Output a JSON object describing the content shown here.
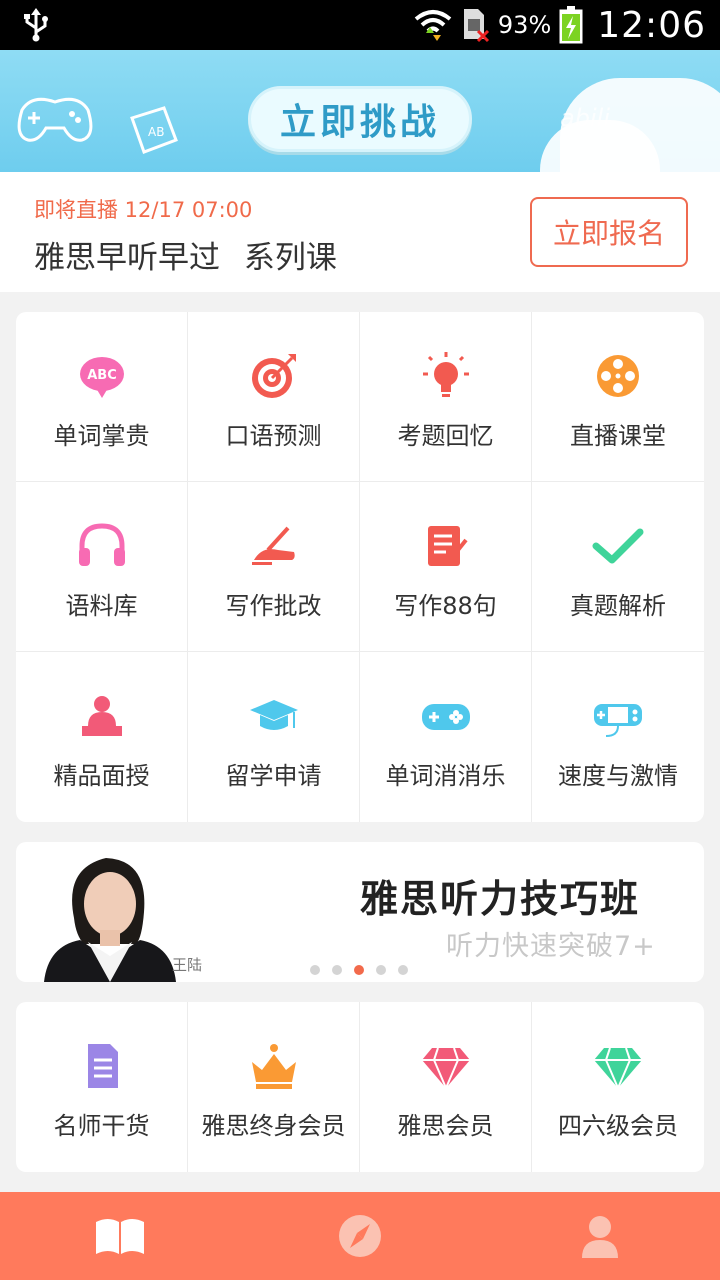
{
  "status_bar": {
    "battery_percent": "93%",
    "time": "12:06"
  },
  "banner": {
    "challenge_label": "立即挑战",
    "deco_text": "abili"
  },
  "live": {
    "note": "即将直播 12/17 07:00",
    "title": "雅思早听早过 系列课",
    "signup_label": "立即报名"
  },
  "features": [
    {
      "label": "单词掌贵",
      "icon": "abc-bubble-icon",
      "color": "#f76bb3"
    },
    {
      "label": "口语预测",
      "icon": "target-icon",
      "color": "#f25a50"
    },
    {
      "label": "考题回忆",
      "icon": "lightbulb-icon",
      "color": "#f25a50"
    },
    {
      "label": "直播课堂",
      "icon": "film-reel-icon",
      "color": "#fa9a34"
    },
    {
      "label": "语料库",
      "icon": "headphones-icon",
      "color": "#f76bb3"
    },
    {
      "label": "写作批改",
      "icon": "writing-hand-icon",
      "color": "#f25a50"
    },
    {
      "label": "写作88句",
      "icon": "notepad-icon",
      "color": "#f25a50"
    },
    {
      "label": "真题解析",
      "icon": "check-icon",
      "color": "#3fd49a"
    },
    {
      "label": "精品面授",
      "icon": "teacher-icon",
      "color": "#f25a78"
    },
    {
      "label": "留学申请",
      "icon": "graduation-cap-icon",
      "color": "#4fc8ec"
    },
    {
      "label": "单词消消乐",
      "icon": "gamepad-icon",
      "color": "#4fc8ec"
    },
    {
      "label": "速度与激情",
      "icon": "handheld-console-icon",
      "color": "#4fc8ec"
    }
  ],
  "ad": {
    "headline": "雅思听力技巧班",
    "subline": "听力快速突破7+",
    "teacher_name": "王陆",
    "slide_count": 5,
    "active_slide": 3
  },
  "vip": [
    {
      "label": "名师干货",
      "icon": "document-icon",
      "color": "#9b86e6"
    },
    {
      "label": "雅思终身会员",
      "icon": "crown-icon",
      "color": "#fa9a34"
    },
    {
      "label": "雅思会员",
      "icon": "diamond-icon",
      "color": "#f25a78"
    },
    {
      "label": "四六级会员",
      "icon": "diamond-icon",
      "color": "#3fd49a"
    }
  ],
  "nav": {
    "items": [
      {
        "name": "study",
        "icon": "book-icon"
      },
      {
        "name": "discover",
        "icon": "compass-icon"
      },
      {
        "name": "profile",
        "icon": "user-icon"
      }
    ]
  }
}
